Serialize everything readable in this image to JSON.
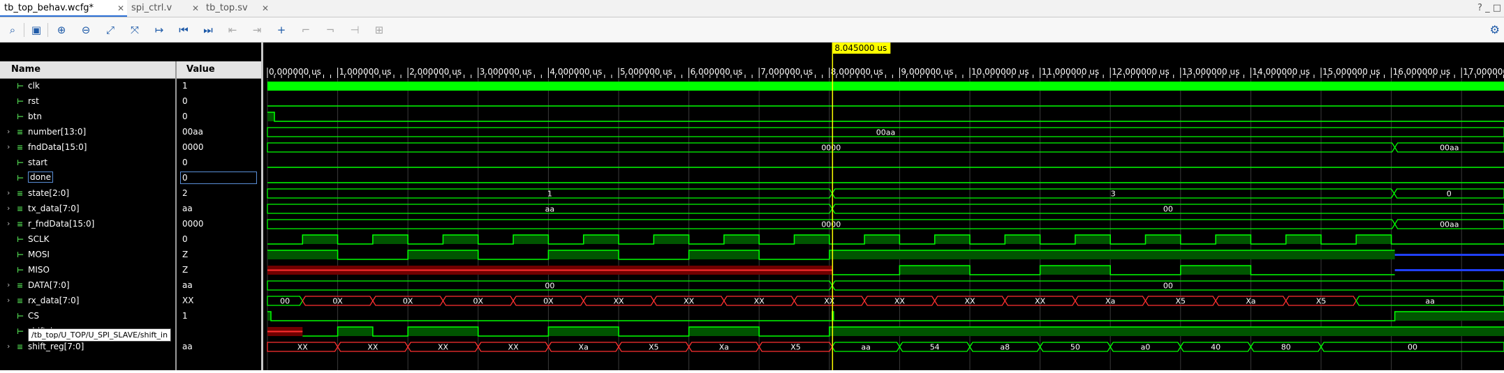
{
  "tabs": [
    {
      "label": "tb_top_behav.wcfg*",
      "active": true
    },
    {
      "label": "spi_ctrl.v",
      "active": false
    },
    {
      "label": "tb_top.sv",
      "active": false
    }
  ],
  "tabs_right": "? _ □",
  "toolbar": {
    "icons": [
      "search-icon",
      "save-icon",
      "zoom-in-icon",
      "zoom-out-icon",
      "zoom-fit-icon",
      "swap-cursor-icon",
      "go-to-cursor-icon",
      "go-to-start-icon",
      "go-to-end-icon",
      "previous-transition-icon",
      "next-transition-icon",
      "add-marker-icon",
      "previous-marker-icon",
      "next-marker-icon",
      "swap-markers-icon",
      "snap-icon"
    ]
  },
  "columns": {
    "name": "Name",
    "value": "Value"
  },
  "cursor": {
    "label": "8.045000 us",
    "time": 8.045
  },
  "tooltip": "/tb_top/U_TOP/U_SPI_SLAVE/shift_in",
  "timeline": {
    "start_us": 0,
    "end_us": 17.7,
    "ticks": [
      "0.000000 us",
      "1.000000 us",
      "2.000000 us",
      "3.000000 us",
      "4.000000 us",
      "5.000000 us",
      "6.000000 us",
      "7.000000 us",
      "8.000000 us",
      "9.000000 us",
      "10.000000 us",
      "11.000000 us",
      "12.000000 us",
      "13.000000 us",
      "14.000000 us",
      "15.000000 us",
      "16.000000 us",
      "17.000000 us"
    ]
  },
  "colors": {
    "wave": "#00ff00",
    "wave_fill": "#005500",
    "unknown": "#ff3030",
    "unknown_fill": "#700000",
    "highz": "#2040ff",
    "cursor": "#ffff00",
    "cursor_label_bg": "#ffff00"
  },
  "signals": [
    {
      "name": "clk",
      "value": "1",
      "expandable": false,
      "kind": "bit"
    },
    {
      "name": "rst",
      "value": "0",
      "expandable": false,
      "kind": "bit"
    },
    {
      "name": "btn",
      "value": "0",
      "expandable": false,
      "kind": "bit"
    },
    {
      "name": "number[13:0]",
      "value": "00aa",
      "expandable": true,
      "kind": "bus"
    },
    {
      "name": "fndData[15:0]",
      "value": "0000",
      "expandable": true,
      "kind": "bus"
    },
    {
      "name": "start",
      "value": "0",
      "expandable": false,
      "kind": "bit"
    },
    {
      "name": "done",
      "value": "0",
      "expandable": false,
      "kind": "bit",
      "selected": true
    },
    {
      "name": "state[2:0]",
      "value": "2",
      "expandable": true,
      "kind": "bus"
    },
    {
      "name": "tx_data[7:0]",
      "value": "aa",
      "expandable": true,
      "kind": "bus"
    },
    {
      "name": "r_fndData[15:0]",
      "value": "0000",
      "expandable": true,
      "kind": "bus"
    },
    {
      "name": "SCLK",
      "value": "0",
      "expandable": false,
      "kind": "bit"
    },
    {
      "name": "MOSI",
      "value": "Z",
      "expandable": false,
      "kind": "bit"
    },
    {
      "name": "MISO",
      "value": "Z",
      "expandable": false,
      "kind": "bit"
    },
    {
      "name": "DATA[7:0]",
      "value": "aa",
      "expandable": true,
      "kind": "bus"
    },
    {
      "name": "rx_data[7:0]",
      "value": "XX",
      "expandable": true,
      "kind": "bus"
    },
    {
      "name": "CS",
      "value": "1",
      "expandable": false,
      "kind": "bit"
    },
    {
      "name": "shift_in",
      "value": "",
      "expandable": false,
      "kind": "bit",
      "tooltip": true
    },
    {
      "name": "shift_reg[7:0]",
      "value": "aa",
      "expandable": true,
      "kind": "bus"
    }
  ],
  "waves": {
    "clk": {
      "type": "clock"
    },
    "rst": {
      "type": "bit",
      "init": 0,
      "tr": []
    },
    "btn": {
      "type": "bit",
      "init": 1,
      "tr": [
        0.1
      ]
    },
    "number": {
      "type": "bus",
      "segs": [
        {
          "t0": 0.0,
          "t1": 17.7,
          "label": "00aa"
        }
      ]
    },
    "fndData": {
      "type": "bus",
      "segs": [
        {
          "t0": 0.0,
          "t1": 16.05,
          "label": "0000"
        },
        {
          "t0": 16.05,
          "t1": 17.7,
          "label": "00aa"
        }
      ]
    },
    "start": {
      "type": "bit",
      "init": 0,
      "tr": []
    },
    "done": {
      "type": "bit",
      "init": 0,
      "tr": []
    },
    "state": {
      "type": "bus",
      "segs": [
        {
          "t0": 0.0,
          "t1": 8.04,
          "label": "1"
        },
        {
          "t0": 8.04,
          "t1": 16.04,
          "label": "3"
        },
        {
          "t0": 16.04,
          "t1": 17.7,
          "label": "0"
        }
      ]
    },
    "tx_data": {
      "type": "bus",
      "segs": [
        {
          "t0": 0.0,
          "t1": 8.04,
          "label": "aa"
        },
        {
          "t0": 8.04,
          "t1": 17.7,
          "label": "00"
        }
      ]
    },
    "r_fndData": {
      "type": "bus",
      "segs": [
        {
          "t0": 0.0,
          "t1": 16.05,
          "label": "0000"
        },
        {
          "t0": 16.05,
          "t1": 17.7,
          "label": "00aa"
        }
      ]
    },
    "SCLK": {
      "type": "bit",
      "init": 0,
      "tr": [
        0.5,
        1.0,
        1.5,
        2.0,
        2.5,
        3.0,
        3.5,
        4.0,
        4.5,
        5.0,
        5.5,
        6.0,
        6.5,
        7.0,
        7.5,
        8.0,
        8.5,
        9.0,
        9.5,
        10.0,
        10.5,
        11.0,
        11.5,
        12.0,
        12.5,
        13.0,
        13.5,
        14.0,
        14.5,
        15.0,
        15.5,
        16.0
      ]
    },
    "MOSI": {
      "type": "bit",
      "init": 1,
      "tr": [
        1.0,
        2.0,
        3.0,
        4.0,
        5.0,
        6.0,
        7.0,
        8.0
      ],
      "highz_from": 16.05
    },
    "MISO": {
      "type": "bit",
      "init": 0,
      "unknown_until": 8.04,
      "tr": [
        9.0,
        10.0,
        11.0,
        12.0,
        13.0,
        14.0
      ],
      "highz_from": 16.05
    },
    "DATA": {
      "type": "bus",
      "segs": [
        {
          "t0": 0.0,
          "t1": 8.04,
          "label": "00"
        },
        {
          "t0": 8.04,
          "t1": 17.7,
          "label": "00"
        }
      ]
    },
    "rx_data": {
      "type": "bus",
      "segs": [
        {
          "t0": 0.0,
          "t1": 0.5,
          "label": "00"
        },
        {
          "t0": 0.5,
          "t1": 1.5,
          "label": "0X",
          "x": true
        },
        {
          "t0": 1.5,
          "t1": 2.5,
          "label": "0X",
          "x": true
        },
        {
          "t0": 2.5,
          "t1": 3.5,
          "label": "0X",
          "x": true
        },
        {
          "t0": 3.5,
          "t1": 4.5,
          "label": "0X",
          "x": true
        },
        {
          "t0": 4.5,
          "t1": 5.5,
          "label": "XX",
          "x": true
        },
        {
          "t0": 5.5,
          "t1": 6.5,
          "label": "XX",
          "x": true
        },
        {
          "t0": 6.5,
          "t1": 7.5,
          "label": "XX",
          "x": true
        },
        {
          "t0": 7.5,
          "t1": 8.5,
          "label": "XX",
          "x": true
        },
        {
          "t0": 8.5,
          "t1": 9.5,
          "label": "XX",
          "x": true
        },
        {
          "t0": 9.5,
          "t1": 10.5,
          "label": "XX",
          "x": true
        },
        {
          "t0": 10.5,
          "t1": 11.5,
          "label": "XX",
          "x": true
        },
        {
          "t0": 11.5,
          "t1": 12.5,
          "label": "Xa",
          "x": true
        },
        {
          "t0": 12.5,
          "t1": 13.5,
          "label": "X5",
          "x": true
        },
        {
          "t0": 13.5,
          "t1": 14.5,
          "label": "Xa",
          "x": true
        },
        {
          "t0": 14.5,
          "t1": 15.5,
          "label": "X5",
          "x": true
        },
        {
          "t0": 15.5,
          "t1": 17.7,
          "label": "aa"
        }
      ]
    },
    "CS": {
      "type": "bit",
      "init": 1,
      "tr": [
        0.05,
        8.04,
        8.06,
        16.05
      ]
    },
    "shift_in": {
      "type": "bit",
      "init": 0,
      "unknown_until": 0.5,
      "tr": [
        1.0,
        1.5,
        2.0,
        3.0,
        4.0,
        5.0,
        6.0,
        7.0,
        8.0
      ]
    },
    "shift_reg": {
      "type": "bus",
      "segs": [
        {
          "t0": 0.0,
          "t1": 1.0,
          "label": "XX",
          "x": true
        },
        {
          "t0": 1.0,
          "t1": 2.0,
          "label": "XX",
          "x": true
        },
        {
          "t0": 2.0,
          "t1": 3.0,
          "label": "XX",
          "x": true
        },
        {
          "t0": 3.0,
          "t1": 4.0,
          "label": "XX",
          "x": true
        },
        {
          "t0": 4.0,
          "t1": 5.0,
          "label": "Xa",
          "x": true
        },
        {
          "t0": 5.0,
          "t1": 6.0,
          "label": "X5",
          "x": true
        },
        {
          "t0": 6.0,
          "t1": 7.0,
          "label": "Xa",
          "x": true
        },
        {
          "t0": 7.0,
          "t1": 8.04,
          "label": "X5",
          "x": true
        },
        {
          "t0": 8.04,
          "t1": 9.0,
          "label": "aa"
        },
        {
          "t0": 9.0,
          "t1": 10.0,
          "label": "54"
        },
        {
          "t0": 10.0,
          "t1": 11.0,
          "label": "a8"
        },
        {
          "t0": 11.0,
          "t1": 12.0,
          "label": "50"
        },
        {
          "t0": 12.0,
          "t1": 13.0,
          "label": "a0"
        },
        {
          "t0": 13.0,
          "t1": 14.0,
          "label": "40"
        },
        {
          "t0": 14.0,
          "t1": 15.0,
          "label": "80"
        },
        {
          "t0": 15.0,
          "t1": 17.7,
          "label": "00"
        }
      ]
    }
  }
}
